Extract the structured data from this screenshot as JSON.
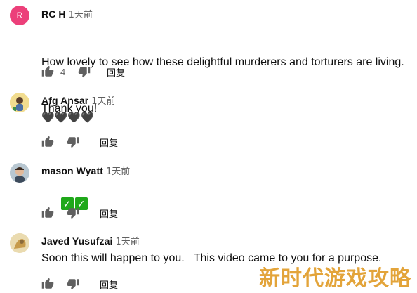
{
  "comments": [
    {
      "author": "RC H",
      "time": "1天前",
      "text_line1": "How lovely to see how these delightful murderers and torturers are living.",
      "text_line2": "Thank you!",
      "likes": "4",
      "reply_label": "回复",
      "avatar_letter": "R"
    },
    {
      "author": "Afg Ansar",
      "time": "1天前",
      "text": "🖤🖤🖤🖤",
      "likes": "",
      "reply_label": "回复"
    },
    {
      "author": "mason Wyatt",
      "time": "1天前",
      "emoji_check": "✓",
      "likes": "",
      "reply_label": "回复"
    },
    {
      "author": "Javed Yusufzai",
      "time": "1天前",
      "text": "Soon this will happen to you.   This video came to you for a purpose.",
      "likes": "",
      "reply_label": "回复"
    }
  ],
  "watermark": "新时代游戏攻略",
  "colors": {
    "avatar_r": "#ec407a",
    "check_green": "#1fa81a",
    "watermark": "#e3a43a"
  },
  "icons": [
    "thumbs-up-icon",
    "thumbs-down-icon"
  ]
}
